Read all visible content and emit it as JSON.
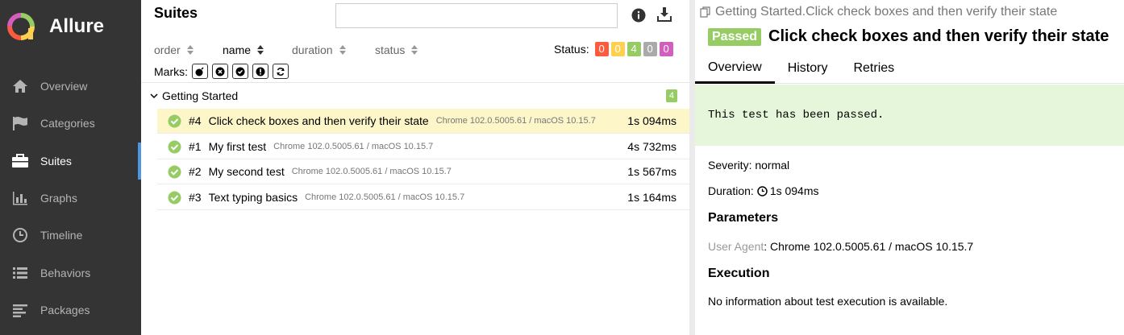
{
  "app": {
    "name": "Allure"
  },
  "sidebar": {
    "items": [
      {
        "label": "Overview",
        "icon": "home-icon"
      },
      {
        "label": "Categories",
        "icon": "flag-icon"
      },
      {
        "label": "Suites",
        "icon": "briefcase-icon",
        "active": true
      },
      {
        "label": "Graphs",
        "icon": "bar-chart-icon"
      },
      {
        "label": "Timeline",
        "icon": "clock-icon"
      },
      {
        "label": "Behaviors",
        "icon": "list-icon"
      },
      {
        "label": "Packages",
        "icon": "align-left-icon"
      }
    ]
  },
  "suites": {
    "title": "Suites",
    "search": {
      "placeholder": "",
      "value": ""
    },
    "sort": {
      "order": "order",
      "name": "name",
      "duration": "duration",
      "status": "status"
    },
    "status_label": "Status:",
    "status_counts": [
      {
        "value": "0",
        "color": "#fd5a3e"
      },
      {
        "value": "0",
        "color": "#ffd050"
      },
      {
        "value": "4",
        "color": "#97cc64"
      },
      {
        "value": "0",
        "color": "#aaaaaa"
      },
      {
        "value": "0",
        "color": "#d35ebe"
      }
    ],
    "marks_label": "Marks:",
    "group": {
      "title": "Getting Started",
      "count": "4"
    },
    "rows": [
      {
        "num": "#4",
        "name": "Click check boxes and then verify their state",
        "param": "Chrome 102.0.5005.61 / macOS 10.15.7",
        "duration": "1s 094ms",
        "selected": true
      },
      {
        "num": "#1",
        "name": "My first test",
        "param": "Chrome 102.0.5005.61 / macOS 10.15.7",
        "duration": "4s 732ms"
      },
      {
        "num": "#2",
        "name": "My second test",
        "param": "Chrome 102.0.5005.61 / macOS 10.15.7",
        "duration": "1s 567ms"
      },
      {
        "num": "#3",
        "name": "Text typing basics",
        "param": "Chrome 102.0.5005.61 / macOS 10.15.7",
        "duration": "1s 164ms"
      }
    ]
  },
  "detail": {
    "breadcrumb": "Getting Started.Click check boxes and then verify their state",
    "status": "Passed",
    "title": "Click check boxes and then verify their state",
    "tabs": [
      "Overview",
      "History",
      "Retries"
    ],
    "pass_message": "This test has been passed.",
    "severity": "Severity: normal",
    "duration_label": "Duration:",
    "duration_value": "1s 094ms",
    "parameters_heading": "Parameters",
    "param_key": "User Agent",
    "param_value": ": Chrome 102.0.5005.61 / macOS 10.15.7",
    "execution_heading": "Execution",
    "execution_text": "No information about test execution is available."
  },
  "colors": {
    "sidebar_bg": "#343434",
    "accent": "#4e98e2",
    "passed": "#97cc64",
    "selected_row": "#fcf6c9",
    "pass_box": "#e6f6db"
  }
}
